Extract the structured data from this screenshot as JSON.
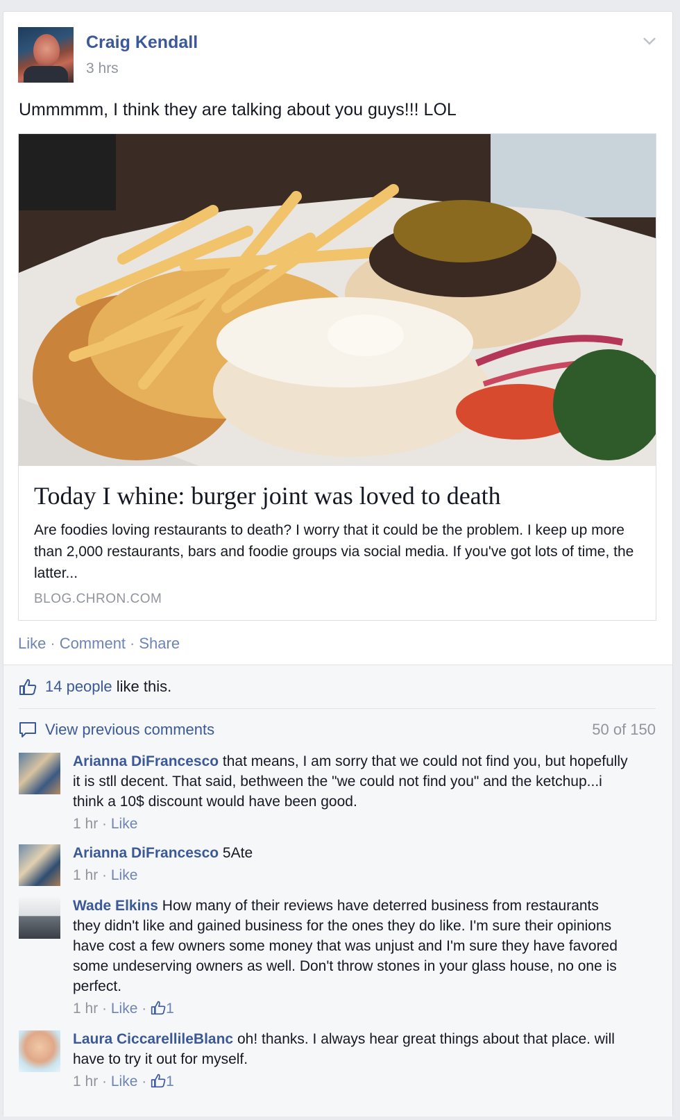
{
  "post": {
    "author": "Craig Kendall",
    "time": "3 hrs",
    "text": "Ummmmm, I think they are talking about you guys!!! LOL"
  },
  "link_preview": {
    "title": "Today I whine: burger joint was loved to death",
    "description": "Are foodies loving restaurants to death? I worry that it could be the problem. I keep up more than 2,000 restaurants, bars and foodie groups via social media. If you've got lots of time, the latter...",
    "domain": "BLOG.CHRON.COM"
  },
  "actions": {
    "like": "Like",
    "comment": "Comment",
    "share": "Share",
    "separator": "·"
  },
  "likes": {
    "people": "14 people",
    "suffix": " like this."
  },
  "comments_header": {
    "view_previous": "View previous comments",
    "count": "50 of 150"
  },
  "comments": [
    {
      "author": "Arianna DiFrancesco",
      "text": "that means, I am sorry that we could not find you, but hopefully it is stll decent. That said, bethween the \"we could not find you\" and the ketchup...i think a 10$ discount would have been good.",
      "time": "1 hr",
      "like": "Like",
      "likes": ""
    },
    {
      "author": "Arianna DiFrancesco",
      "text": "5Ate",
      "time": "1 hr",
      "like": "Like",
      "likes": ""
    },
    {
      "author": "Wade Elkins",
      "text": "How many of their reviews have deterred business from restaurants they didn't like and gained business for the ones they do like. I'm sure their opinions have cost a few owners some money that was unjust and I'm sure they have favored some undeserving owners as well. Don't throw stones in your glass house, no one is perfect.",
      "time": "1 hr",
      "like": "Like",
      "likes": "1"
    },
    {
      "author": "Laura CiccarellileBlanc",
      "text": "oh! thanks. I always hear great things about that place. will have to try it out for myself.",
      "time": "1 hr",
      "like": "Like",
      "likes": "1"
    }
  ],
  "colors": {
    "link_blue": "#3b5998",
    "action_blue": "#6d84b4",
    "meta_gray": "#90949c"
  }
}
